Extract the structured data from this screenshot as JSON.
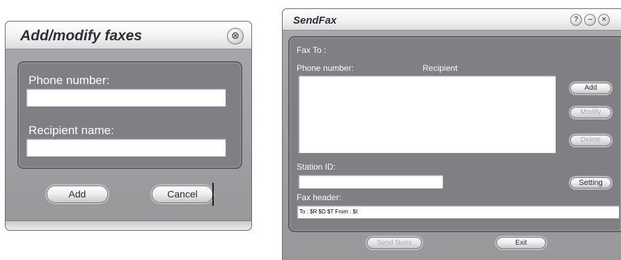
{
  "add_modify_dialog": {
    "title": "Add/modify faxes",
    "close_glyph": "⊗",
    "phone_label": "Phone number:",
    "phone_value": "",
    "recipient_label": "Recipient name:",
    "recipient_value": "",
    "add_label": "Add",
    "cancel_label": "Cancel"
  },
  "sendfax_window": {
    "title": "SendFax",
    "help_glyph": "?",
    "minimize_glyph": "–",
    "close_glyph": "×",
    "fax_to_label": "Fax To :",
    "columns": [
      "Phone number:",
      "Recipient"
    ],
    "add_label": "Add",
    "modify_label": "Modify",
    "delete_label": "Delete",
    "station_id_label": "Station ID:",
    "station_id_value": "",
    "setting_label": "Setting",
    "fax_header_label": "Fax header:",
    "fax_header_value": "To : $R        $D $T               From : $I",
    "send_faxes_label": "Send faxes",
    "exit_label": "Exit"
  },
  "icons": [
    "close-icon",
    "help-icon",
    "minimize-icon"
  ],
  "colors": {
    "panel": "#7f7f84",
    "window_body": "#a9a9ac",
    "titlebar": "#f1f1f2",
    "disabled_text": "#a9a9ad"
  }
}
